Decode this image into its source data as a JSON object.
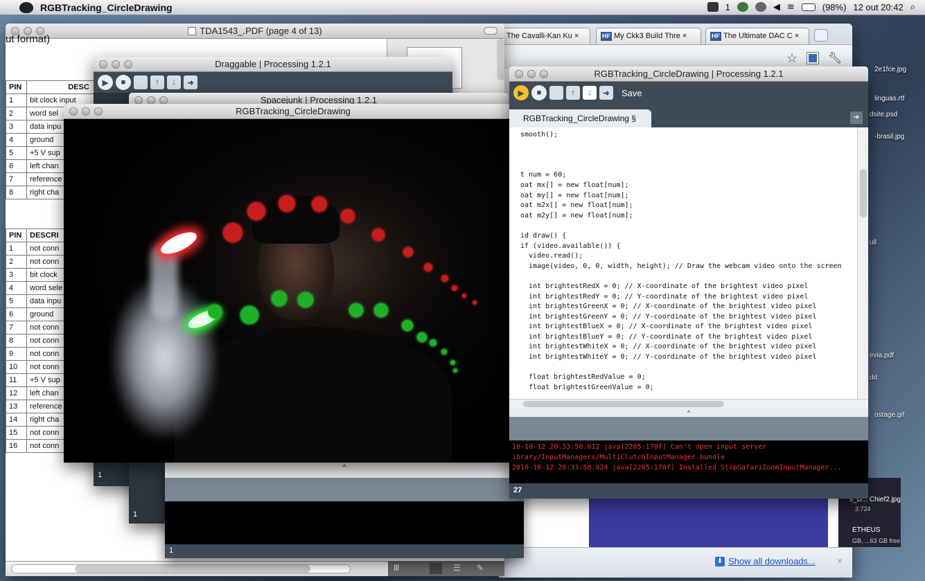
{
  "menubar": {
    "app_name": "RGBTracking_CircleDrawing",
    "status_number": "1",
    "battery": "(98%)",
    "datetime": "12 out 20:42"
  },
  "pdf": {
    "title": "TDA1543_.PDF (page 4 of 13)",
    "heading_fragment": "ut format)",
    "table1": {
      "headers": [
        "PIN",
        "DESC"
      ],
      "rows": [
        [
          "1",
          "bit clock input"
        ],
        [
          "2",
          "word sel"
        ],
        [
          "3",
          "data inpu"
        ],
        [
          "4",
          "ground"
        ],
        [
          "5",
          "+5 V sup"
        ],
        [
          "6",
          "left chan"
        ],
        [
          "7",
          "reference"
        ],
        [
          "8",
          "right cha"
        ]
      ]
    },
    "table2": {
      "headers": [
        "PIN",
        "DESCRI"
      ],
      "rows": [
        [
          "1",
          "not conn"
        ],
        [
          "2",
          "not conn"
        ],
        [
          "3",
          "bit clock"
        ],
        [
          "4",
          "word sele"
        ],
        [
          "5",
          "data inpu"
        ],
        [
          "6",
          "ground"
        ],
        [
          "7",
          "not conn"
        ],
        [
          "8",
          "not conn"
        ],
        [
          "9",
          "not conn"
        ],
        [
          "10",
          "not conn"
        ],
        [
          "11",
          "+5 V sup"
        ],
        [
          "12",
          "left chan"
        ],
        [
          "13",
          "reference"
        ],
        [
          "14",
          "right cha"
        ],
        [
          "15",
          "not conn"
        ],
        [
          "16",
          "not conn"
        ]
      ]
    }
  },
  "browser": {
    "tabs": [
      {
        "label": "The Cavalli-Kan Ku",
        "favicon": ""
      },
      {
        "label": "My Ckk3 Build Thre",
        "favicon": "HF"
      },
      {
        "label": "The Ultimate DAC C",
        "favicon": "HF"
      }
    ],
    "close_glyph": "×",
    "downloads_link": "Show all downloads...",
    "download_item_1": "s_D... Chief2.jpg",
    "download_item_1_sub": "3.724",
    "download_item_2": "ETHEUS",
    "download_item_2_sub": "GB, ...63 GB free"
  },
  "desktop_files": [
    "2e1fce.jpg",
    "linguas.rtf",
    "dsite.psd",
    "-brasil.jpg",
    "ull",
    "evia.pdf",
    "dd",
    "ostage.gif"
  ],
  "draggable": {
    "title": "Draggable | Processing 1.2.1",
    "line": "1"
  },
  "spacejunk": {
    "title": "Spacejunk | Processing 1.2.1",
    "line": "1"
  },
  "sketch": {
    "title": "RGBTracking_CircleDrawing",
    "footer_line": "1",
    "collapse_glyph": "^"
  },
  "editor": {
    "title": "RGBTracking_CircleDrawing | Processing 1.2.1",
    "save_label": "Save",
    "tab_label": "RGBTracking_CircleDrawing §",
    "code_lines": [
      "smooth();",
      "",
      "",
      "",
      "t num = 60;",
      "oat mx[] = new float[num];",
      "oat my[] = new float[num];",
      "oat m2x[] = new float[num];",
      "oat m2y[] = new float[num];",
      "",
      "id draw() {",
      "if (video.available()) {",
      "  video.read();",
      "  image(video, 0, 0, width, height); // Draw the webcam video onto the screen",
      "",
      "  int brightestRedX = 0; // X-coordinate of the brightest video pixel",
      "  int brightestRedY = 0; // Y-coordinate of the brightest video pixel",
      "  int brightestGreenX = 0; // X-coordinate of the brightest video pixel",
      "  int brightestGreenY = 0; // Y-coordinate of the brightest video pixel",
      "  int brightestBlueX = 0; // X-coordinate of the brightest video pixel",
      "  int brightestBlueY = 0; // Y-coordinate of the brightest video pixel",
      "  int brightestWhiteX = 0; // X-coordinate of the brightest video pixel",
      "  int brightestWhiteY = 0; // Y-coordinate of the brightest video pixel",
      "",
      "  float brightestRedValue = 0;",
      "  float brightestGreenValue = 0;"
    ],
    "console_lines": [
      "10-10-12 20:33:50.012 java[2205:170f] Can't open input server",
      "ibrary/InputManagers/MultiClutchInputManager.bundle",
      "2010-10-12 20:33:50.024 java[2205:170f] Installed StopSafariZoomInputManager..."
    ],
    "line_number": "27",
    "collapse_glyph": "^"
  },
  "colors": {
    "processing_bar": "#3d4b57",
    "play": "#f2c12e",
    "console_text": "#e33333",
    "link": "#1a4fc9"
  },
  "icons": [
    "apple-icon",
    "wifi-icon",
    "volume-icon",
    "battery-icon",
    "search-icon",
    "star-icon",
    "wrench-icon",
    "play-icon",
    "stop-icon",
    "new-icon",
    "open-icon",
    "export-icon",
    "download-icon"
  ]
}
